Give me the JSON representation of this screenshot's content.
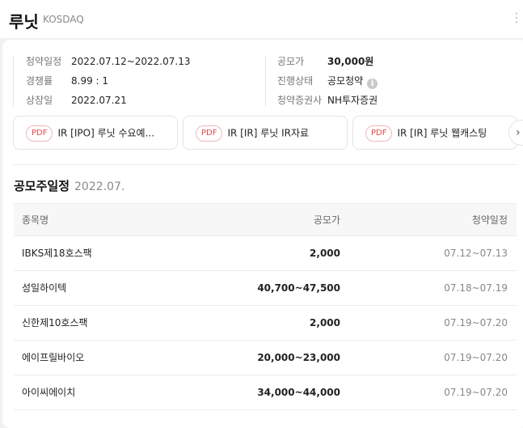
{
  "header": {
    "stock_name": "루닛",
    "market": "KOSDAQ",
    "more_icon": "⋮"
  },
  "info": {
    "left": [
      {
        "label": "청약일정",
        "value": "2022.07.12~2022.07.13"
      },
      {
        "label": "경쟁률",
        "value": "8.99 : 1"
      },
      {
        "label": "상장일",
        "value": "2022.07.21"
      }
    ],
    "right": [
      {
        "label": "공모가",
        "value": "30,000원"
      },
      {
        "label": "진행상태",
        "value": "공모청약"
      },
      {
        "label": "청약증권사",
        "value": "NH투자증권"
      }
    ],
    "info_icon": "i"
  },
  "documents": {
    "items": [
      {
        "badge": "PDF",
        "text": "IR [IPO] 루닛 수요예..."
      },
      {
        "badge": "PDF",
        "text": "IR [IR] 루닛 IR자료"
      },
      {
        "badge": "PDF",
        "text": "IR [IR] 루닛 웹캐스팅"
      }
    ],
    "next_icon": "›"
  },
  "schedule": {
    "title": "공모주일정",
    "month": "2022.07.",
    "columns": [
      "종목명",
      "공모가",
      "청약일정"
    ],
    "rows": [
      {
        "name": "IBKS제18호스팩",
        "price": "2,000",
        "period": "07.12~07.13"
      },
      {
        "name": "성일하이텍",
        "price": "40,700~47,500",
        "period": "07.18~07.19"
      },
      {
        "name": "신한제10호스팩",
        "price": "2,000",
        "period": "07.19~07.20"
      },
      {
        "name": "에이프릴바이오",
        "price": "20,000~23,000",
        "period": "07.19~07.20"
      },
      {
        "name": "아이씨에이치",
        "price": "34,000~44,000",
        "period": "07.19~07.20"
      }
    ]
  },
  "colors": {
    "pdf_badge": "#e14a4a",
    "background": "#f1f1f3"
  }
}
